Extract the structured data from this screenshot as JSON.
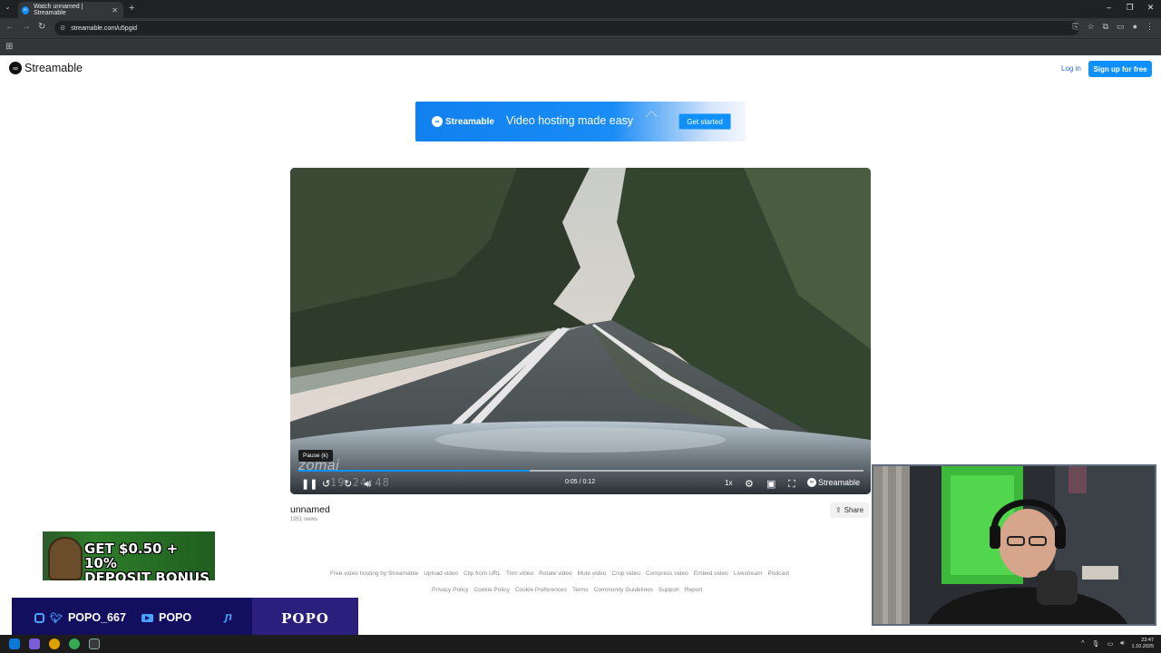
{
  "browser": {
    "tab_title": "Watch unnamed | Streamable",
    "url": "streamable.com/u5pgid"
  },
  "header": {
    "logo_text": "Streamable",
    "login": "Log in",
    "signup": "Sign up for free"
  },
  "banner": {
    "brand": "Streamable",
    "tagline": "Video hosting made easy",
    "cta": "Get started"
  },
  "player": {
    "tooltip": "Pause (k)",
    "overlay_watermark": "zomai",
    "overlay_timestamp": "19:24:48",
    "time_display": "0:05 / 0:12",
    "progress": 0.41,
    "speed": "1x",
    "brand": "Streamable"
  },
  "video": {
    "title": "unnamed",
    "views": "1951 views",
    "share": "Share"
  },
  "footer": {
    "row1": [
      "Free video hosting by Streamable",
      "Upload video",
      "Clip from URL",
      "Trim video",
      "Rotate video",
      "Mute video",
      "Crop video",
      "Compress video",
      "Embed video",
      "Livestream",
      "Podcast"
    ],
    "row2": [
      "Privacy Policy",
      "Cookie Policy",
      "Cookie Preferences",
      "Terms",
      "Community Guidelines",
      "Support",
      "Report"
    ]
  },
  "overlay": {
    "promo_line1": "GET $0.50 + 10%",
    "promo_line2": "DEPOSIT BONUS",
    "social_handle_1": "POPO_667",
    "social_handle_2": "POPO",
    "streamer_name": "POPO"
  },
  "taskbar": {
    "time": "23:47",
    "date": "1.10.2025"
  },
  "colors": {
    "accent": "#0f90fa",
    "chrome_dark": "#202124",
    "stream_bar": "#110f5e"
  }
}
